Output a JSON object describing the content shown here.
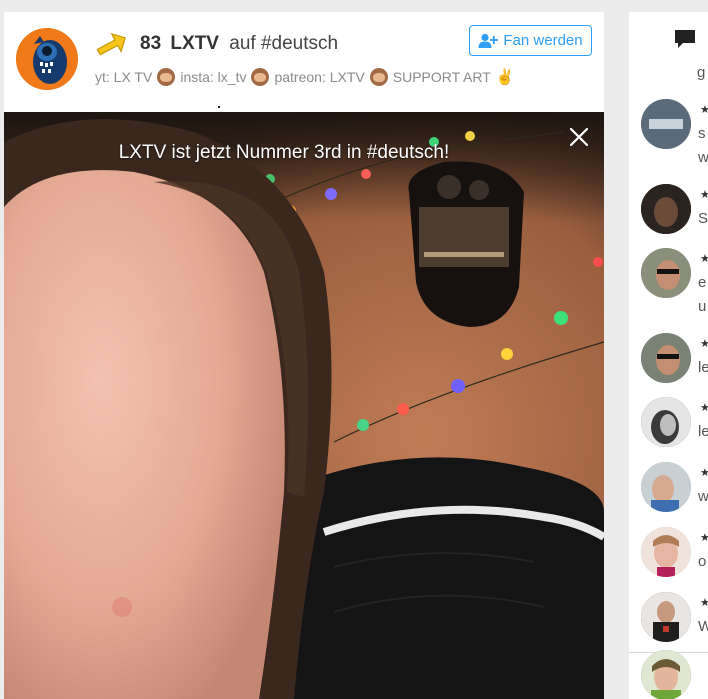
{
  "stream": {
    "rank": "83",
    "name": "LXTV",
    "connector": "auf",
    "tag": "#deutsch",
    "subtitle": {
      "yt": "yt: LX TV",
      "insta": "insta: lx_tv",
      "patreon": "patreon: LXTV",
      "support": "SUPPORT ART"
    },
    "fan_button_label": "Fan werden"
  },
  "video": {
    "notice": "LXTV ist jetzt Nummer 3rd in #deutsch!"
  },
  "chat": {
    "first_letter": "g",
    "messages": [
      {
        "star": "★",
        "lines": [
          "s",
          "w"
        ],
        "avatar": "#5b6b7c"
      },
      {
        "star": "★",
        "lines": [
          "S"
        ],
        "avatar": "#2b2320"
      },
      {
        "star": "★",
        "lines": [
          "e",
          "u"
        ],
        "avatar": "#8a8f7c"
      },
      {
        "star": "★",
        "lines": [
          "le"
        ],
        "avatar": "#7a8275"
      },
      {
        "star": "★",
        "lines": [
          "le"
        ],
        "avatar": "#4a4a4a"
      },
      {
        "star": "★",
        "lines": [
          "w"
        ],
        "avatar": "#9aa3a8"
      },
      {
        "star": "★",
        "lines": [
          "o"
        ],
        "avatar": "#c79c8c"
      },
      {
        "star": "★",
        "lines": [
          "W"
        ],
        "avatar": "#3a2e2a"
      }
    ],
    "last_avatar": "#7b8a58"
  },
  "colors": {
    "accent": "#2f9ff4",
    "avatar_bg": "#f07a1a"
  }
}
